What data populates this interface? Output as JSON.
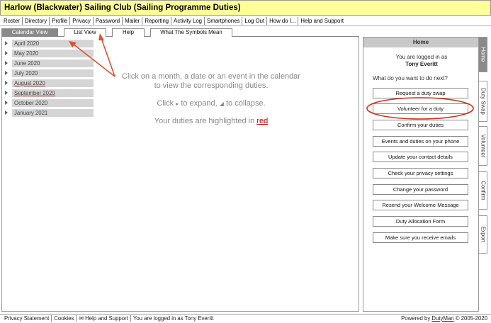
{
  "title": "Harlow (Blackwater) Sailing Club (Sailing Programme Duties)",
  "menu": [
    "Roster",
    "Directory",
    "Profile",
    "Privacy",
    "Password",
    "Mailer",
    "Reporting",
    "Activity Log",
    "Smartphones",
    "Log Out",
    "How do I...",
    "Help and Support"
  ],
  "tabs": [
    "Calendar View",
    "List View",
    "Help",
    "What The Symbols Mean"
  ],
  "active_tab": "Calendar View",
  "months": [
    "April 2020",
    "May 2020",
    "June 2020",
    "July 2020",
    "August 2020",
    "September 2020",
    "October 2020",
    "January 2021"
  ],
  "highlighted_months": [
    "August 2020",
    "September 2020"
  ],
  "instructions": {
    "line1": "Click on a month, a date or an event in the calendar",
    "line2": "to view the corresponding duties.",
    "expand_prefix": "Click",
    "expand_middle": "to expand,",
    "expand_suffix": "to collapse.",
    "highlight_prefix": "Your duties are highlighted in",
    "highlight_word": "red"
  },
  "right_panel": {
    "header": "Home",
    "logged_in_as": "You are logged in as",
    "user": "Tony Everitt",
    "question": "What do you want to do next?",
    "buttons": [
      "Request a duty swap",
      "Volunteer for a duty",
      "Confirm your duties",
      "Events and duties on your phone",
      "Update your contact details",
      "Check your privacy settings",
      "Change your password",
      "Resend your Welcome Message",
      "Duty Allocation Form",
      "Make sure you receive emails"
    ],
    "circled_button": "Volunteer for a duty"
  },
  "side_tabs": [
    "Home",
    "Duty Swap",
    "Volunteer",
    "Confirm",
    "Export"
  ],
  "active_side_tab": "Home",
  "footer": {
    "privacy": "Privacy Statement",
    "cookies": "Cookies",
    "help_icon": "envelope-icon",
    "help": "Help and Support",
    "logged_in": "You are logged in as Tony Everitt",
    "powered_by": "Powered by",
    "brand": "DutyMan",
    "copyright": "© 2005-2020"
  },
  "colors": {
    "title_bg": "#ffff99",
    "annotation_red": "#e05030",
    "duty_red": "#cc0000",
    "tab_active": "#8a8a8a"
  }
}
